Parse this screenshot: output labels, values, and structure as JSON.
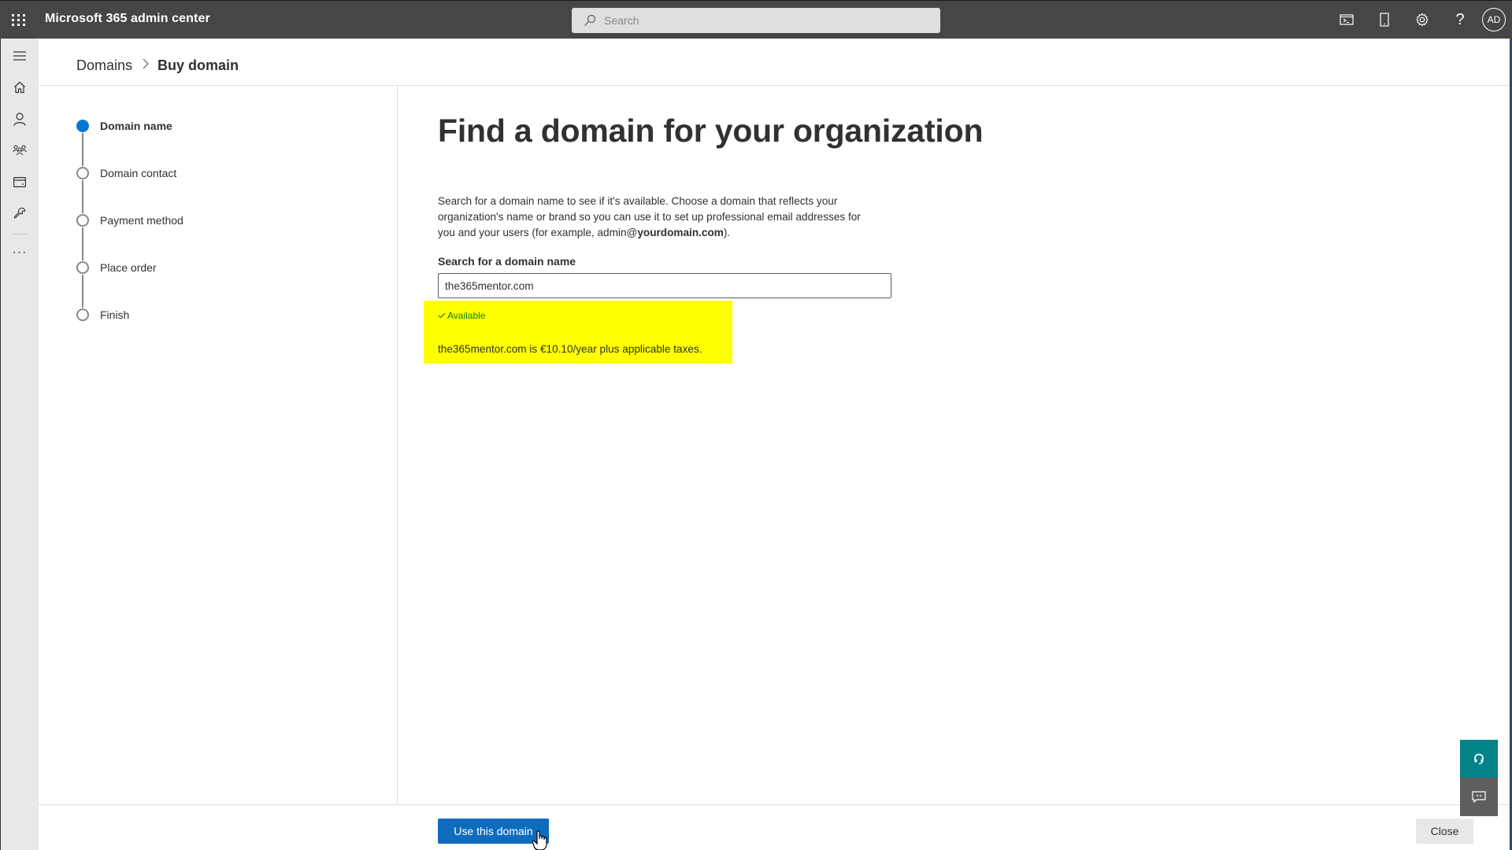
{
  "header": {
    "app_title": "Microsoft 365 admin center",
    "search_placeholder": "Search",
    "icons": [
      "app-launcher-icon",
      "search-icon",
      "terminal-icon",
      "mobile-icon",
      "settings-icon",
      "help-icon"
    ],
    "avatar_initials": "AD"
  },
  "sidebar": {
    "items": [
      {
        "name": "menu",
        "icon": "hamburger-icon"
      },
      {
        "name": "home",
        "icon": "home-icon"
      },
      {
        "name": "users",
        "icon": "user-icon"
      },
      {
        "name": "teams-groups",
        "icon": "group-icon"
      },
      {
        "name": "billing",
        "icon": "credit-card-icon"
      },
      {
        "name": "setup",
        "icon": "wrench-icon"
      },
      {
        "name": "more",
        "icon": "more-icon"
      }
    ]
  },
  "breadcrumb": {
    "parent": "Domains",
    "current": "Buy domain"
  },
  "steps": [
    {
      "label": "Domain name",
      "status": "active"
    },
    {
      "label": "Domain contact",
      "status": "pending"
    },
    {
      "label": "Payment method",
      "status": "pending"
    },
    {
      "label": "Place order",
      "status": "pending"
    },
    {
      "label": "Finish",
      "status": "pending"
    }
  ],
  "main": {
    "title": "Find a domain for your organization",
    "description_pre": "Search for a domain name to see if it's available. Choose a domain that reflects your organization's name or brand so you can use it to set up professional email addresses for you and your users (for example, admin@",
    "description_bold": "yourdomain.com",
    "description_post": ").",
    "search_label": "Search for a domain name",
    "search_value": "the365mentor.com",
    "availability": "Available",
    "price_text": "the365mentor.com is €10.10/year plus applicable taxes."
  },
  "footer": {
    "primary_label": "Use this domain",
    "close_label": "Close"
  },
  "colors": {
    "header_bg": "#484644",
    "accent": "#0078d4",
    "primary_button": "#0f6cbd",
    "available_green": "#107c10",
    "highlight": "#ffff00",
    "help_teal": "#038387"
  }
}
